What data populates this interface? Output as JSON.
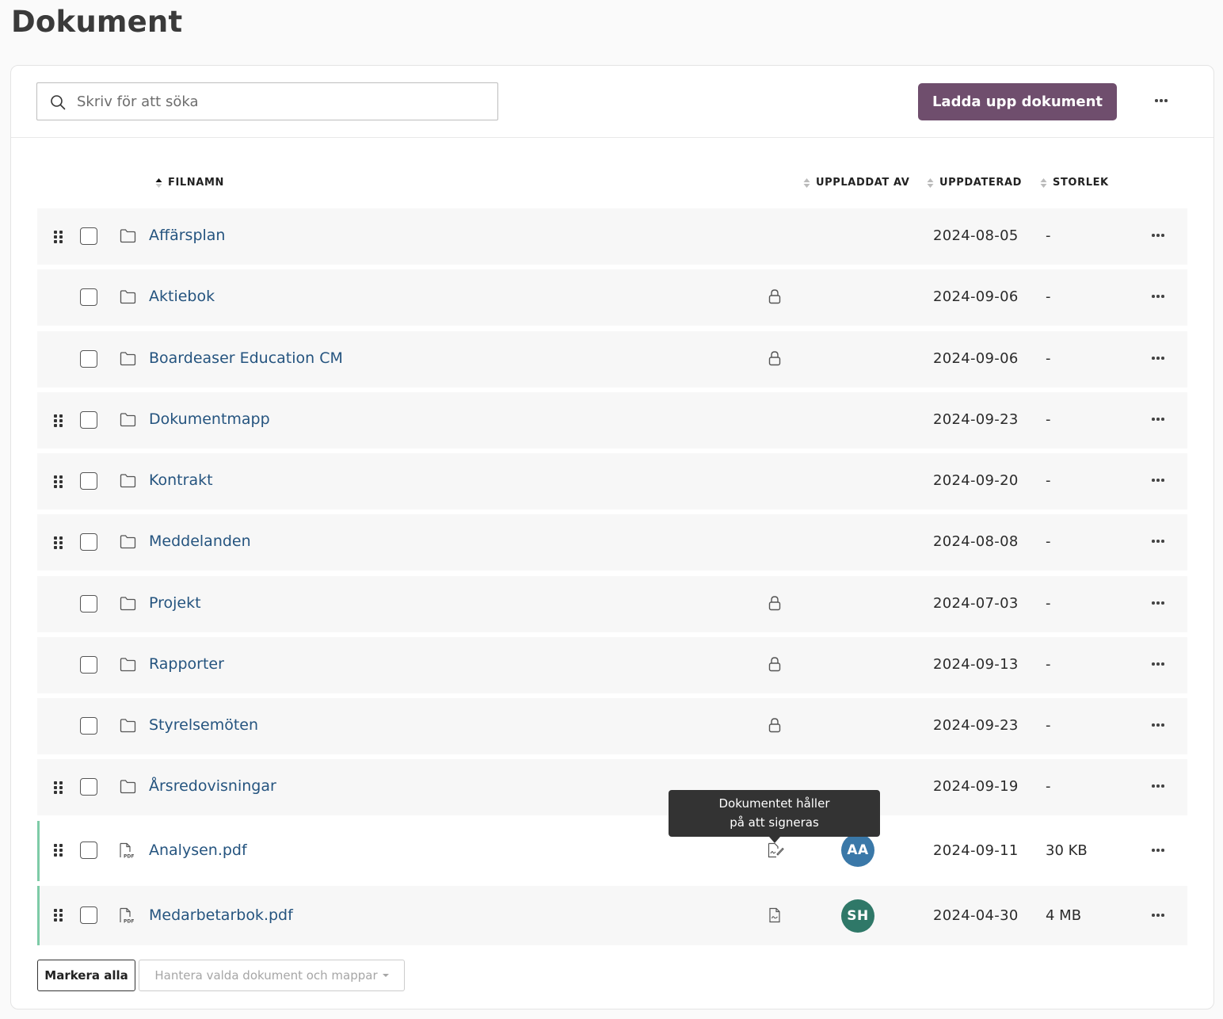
{
  "page": {
    "title": "Dokument"
  },
  "toolbar": {
    "search_placeholder": "Skriv för att söka",
    "upload_label": "Ladda upp dokument"
  },
  "columns": {
    "filename": "FILNAMN",
    "uploaded_by": "UPPLADDAT AV",
    "updated": "UPPDATERAD",
    "size": "STORLEK"
  },
  "rows": [
    {
      "type": "folder",
      "name": "Affärsplan",
      "draggable": true,
      "locked": false,
      "updated": "2024-08-05",
      "size": "-"
    },
    {
      "type": "folder",
      "name": "Aktiebok",
      "draggable": false,
      "locked": true,
      "updated": "2024-09-06",
      "size": "-"
    },
    {
      "type": "folder",
      "name": "Boardeaser Education CM",
      "draggable": false,
      "locked": true,
      "updated": "2024-09-06",
      "size": "-"
    },
    {
      "type": "folder",
      "name": "Dokumentmapp",
      "draggable": true,
      "locked": false,
      "updated": "2024-09-23",
      "size": "-"
    },
    {
      "type": "folder",
      "name": "Kontrakt",
      "draggable": true,
      "locked": false,
      "updated": "2024-09-20",
      "size": "-"
    },
    {
      "type": "folder",
      "name": "Meddelanden",
      "draggable": true,
      "locked": false,
      "updated": "2024-08-08",
      "size": "-"
    },
    {
      "type": "folder",
      "name": "Projekt",
      "draggable": false,
      "locked": true,
      "updated": "2024-07-03",
      "size": "-"
    },
    {
      "type": "folder",
      "name": "Rapporter",
      "draggable": false,
      "locked": true,
      "updated": "2024-09-13",
      "size": "-"
    },
    {
      "type": "folder",
      "name": "Styrelsemöten",
      "draggable": false,
      "locked": true,
      "updated": "2024-09-23",
      "size": "-"
    },
    {
      "type": "folder",
      "name": "Årsredovisningar",
      "draggable": true,
      "locked": false,
      "updated": "2024-09-19",
      "size": "-"
    },
    {
      "type": "pdf",
      "name": "Analysen.pdf",
      "draggable": true,
      "status_icon": "signing-icon",
      "uploader": "AA",
      "uploader_color": "#3a78a8",
      "updated": "2024-09-11",
      "size": "30 KB"
    },
    {
      "type": "pdf",
      "name": "Medarbetarbok.pdf",
      "draggable": true,
      "status_icon": "document-icon",
      "uploader": "SH",
      "uploader_color": "#2f7868",
      "updated": "2024-04-30",
      "size": "4 MB"
    }
  ],
  "tooltip": {
    "line1": "Dokumentet håller",
    "line2": "på att signeras"
  },
  "footer": {
    "select_all": "Markera alla",
    "manage_selected": "Hantera valda dokument och mappar"
  },
  "colors": {
    "primary": "#6f4e6d",
    "link": "#25547f",
    "file_accent": "#7ecba7"
  }
}
